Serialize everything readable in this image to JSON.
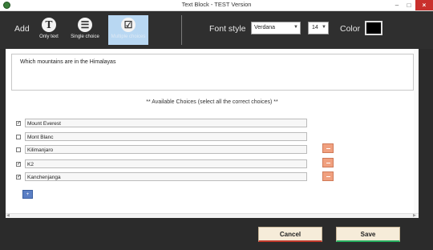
{
  "window": {
    "title": "Text Block - TEST Version",
    "minimize": "–",
    "maximize": "□",
    "close": "×"
  },
  "toolbar": {
    "add_label": "Add",
    "tools": [
      {
        "label": "Only text",
        "icon": "T"
      },
      {
        "label": "Single choice",
        "icon": "☰"
      },
      {
        "label": "Multiple choices",
        "icon": "☑"
      }
    ],
    "font_style_label": "Font style",
    "font_family": "Verdana",
    "font_size": "14",
    "color_label": "Color",
    "color_value": "#000000"
  },
  "question": {
    "text": "Which mountains are in the Himalayas"
  },
  "choices_header": "** Available Choices (select all the correct choices) **",
  "choices": [
    {
      "text": "Mount Everest",
      "checked": true,
      "removable": false
    },
    {
      "text": "Mont Blanc",
      "checked": false,
      "removable": false
    },
    {
      "text": "Kilimanjaro",
      "checked": false,
      "removable": true
    },
    {
      "text": "K2",
      "checked": true,
      "removable": true
    },
    {
      "text": "Kanchenjanga",
      "checked": true,
      "removable": true
    }
  ],
  "add_choice_symbol": "+",
  "actions": {
    "cancel_label": "Cancel",
    "save_label": "Save"
  }
}
